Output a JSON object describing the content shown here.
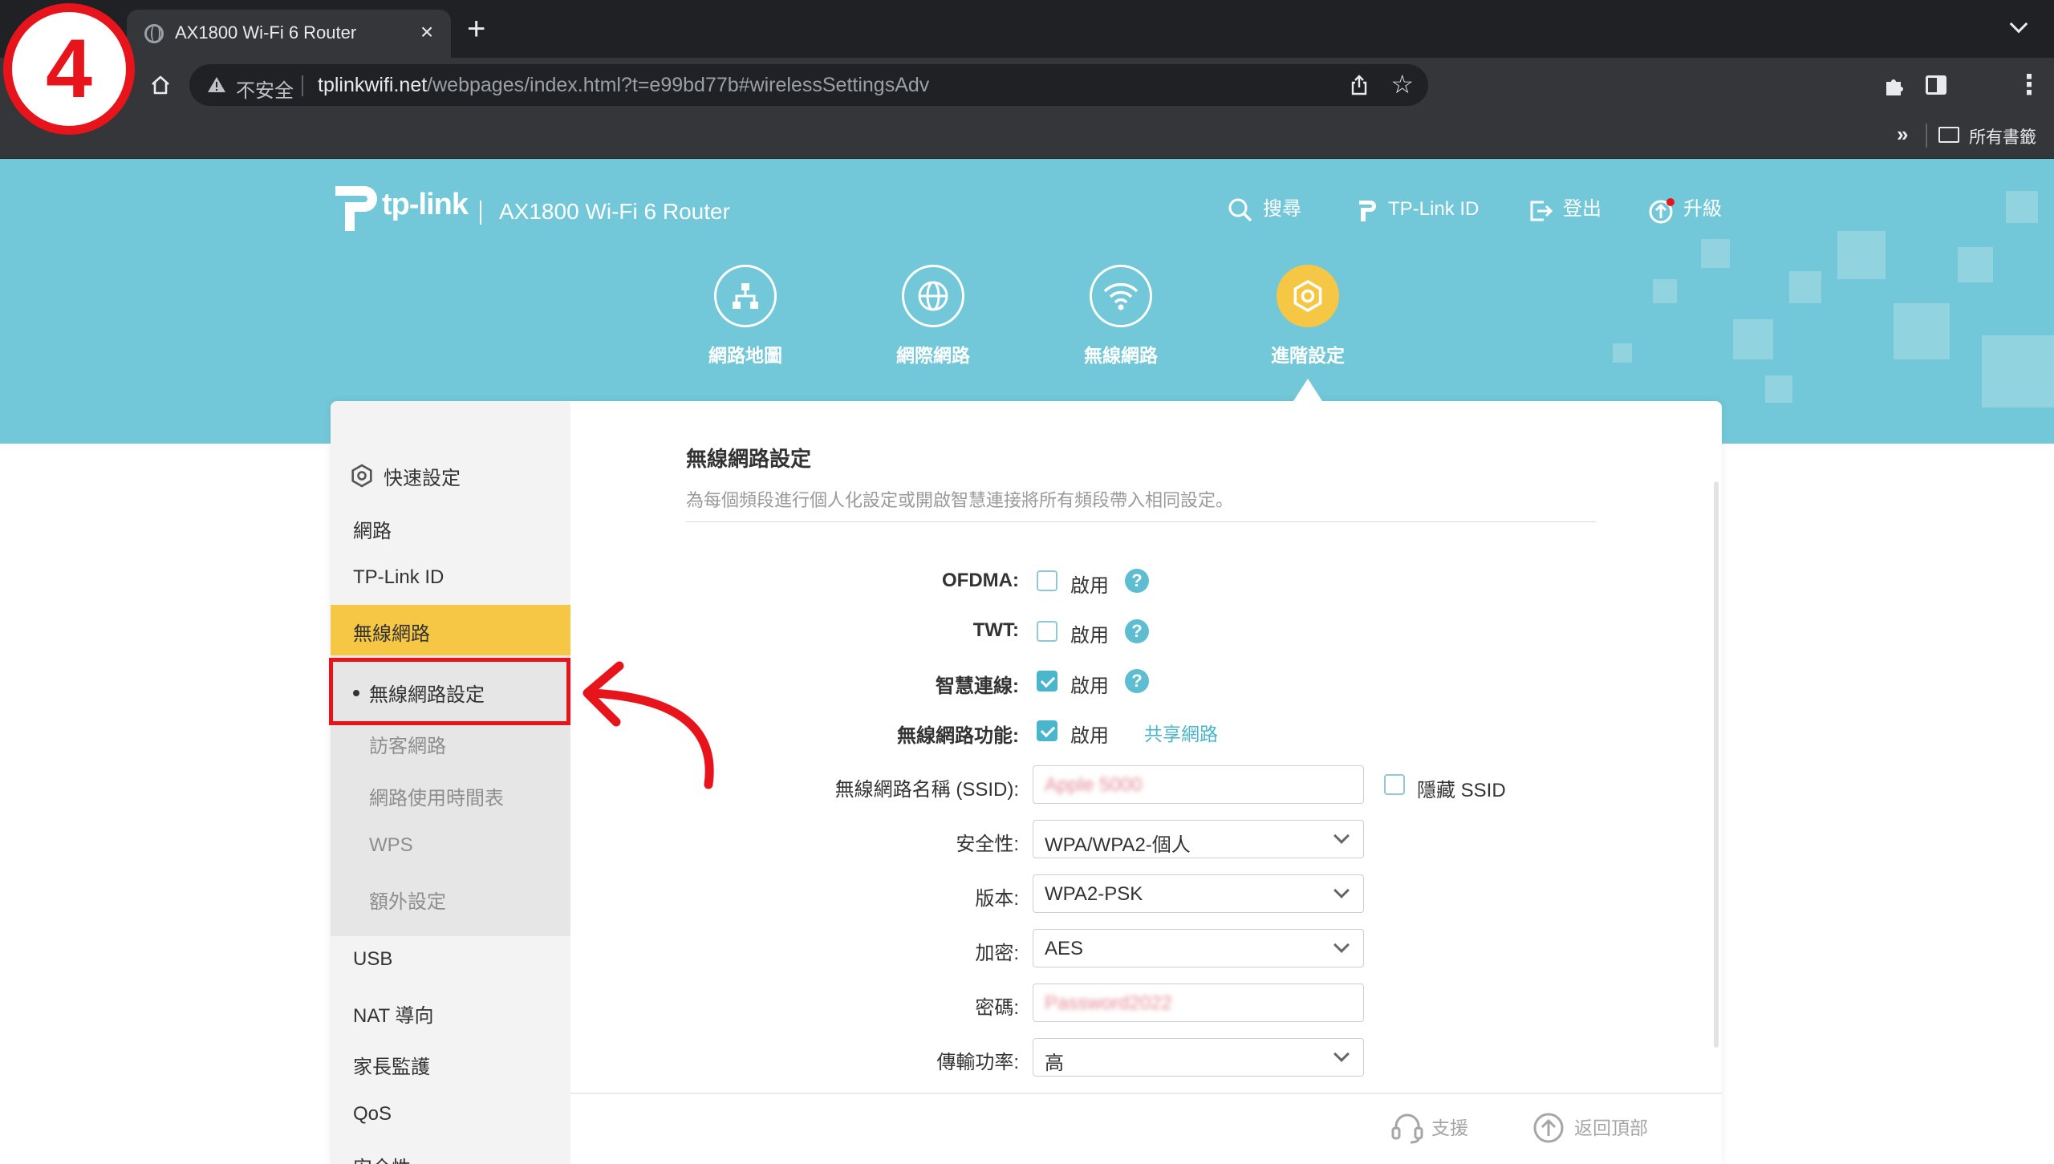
{
  "browser": {
    "tab_title": "AX1800 Wi-Fi 6 Router",
    "tab_close": "×",
    "new_tab": "+",
    "insecure_label": "不安全",
    "url_host": "tplinkwifi.net",
    "url_path": "/webpages/index.html?t=e99bd77b#wirelessSettingsAdv",
    "bookmarks_more": "»",
    "bookmarks_folder": "所有書籤",
    "menu_glyph": "⋮",
    "star_glyph": "☆"
  },
  "annotation": {
    "step_number": "4",
    "accent_color": "#e8141b"
  },
  "header": {
    "logo_text": "tp-link",
    "product_name": "AX1800 Wi-Fi 6 Router",
    "links": {
      "search": "搜尋",
      "tplink_id": "TP-Link ID",
      "logout": "登出",
      "upgrade": "升級"
    }
  },
  "top_nav": {
    "items": [
      {
        "label": "網路地圖",
        "icon": "network-map-icon"
      },
      {
        "label": "網際網路",
        "icon": "globe-icon"
      },
      {
        "label": "無線網路",
        "icon": "wifi-icon"
      },
      {
        "label": "進階設定",
        "icon": "advanced-gear-icon",
        "active": true
      }
    ]
  },
  "sidebar": {
    "quick_setup": "快速設定",
    "network": "網路",
    "tplink_id": "TP-Link ID",
    "wireless": "無線網路",
    "wireless_sub": {
      "settings": "無線網路設定",
      "guest": "訪客網路",
      "schedule": "網路使用時間表",
      "wps": "WPS",
      "additional": "額外設定"
    },
    "usb": "USB",
    "nat": "NAT 導向",
    "parental": "家長監護",
    "qos": "QoS",
    "security": "安全性"
  },
  "content": {
    "title": "無線網路設定",
    "description": "為每個頻段進行個人化設定或開啟智慧連接將所有頻段帶入相同設定。",
    "enable_label": "啟用",
    "help_glyph": "?",
    "ofdma": {
      "label": "OFDMA:",
      "checked": false
    },
    "twt": {
      "label": "TWT:",
      "checked": false
    },
    "smart_connect": {
      "label": "智慧連線:",
      "checked": true
    },
    "wireless_function": {
      "label": "無線網路功能:",
      "checked": true
    },
    "share_network": "共享網路",
    "ssid_label": "無線網路名稱 (SSID):",
    "ssid_value": "Apple 5000",
    "hide_ssid": {
      "label": "隱藏 SSID",
      "checked": false
    },
    "security_label": "安全性:",
    "security_value": "WPA/WPA2-個人",
    "version_label": "版本:",
    "version_value": "WPA2-PSK",
    "encryption_label": "加密:",
    "encryption_value": "AES",
    "password_label": "密碼:",
    "password_value": "Password2022",
    "tx_power_label": "傳輸功率:",
    "tx_power_value": "高"
  },
  "footer": {
    "support": "支援",
    "back_to_top": "返回頂部"
  },
  "colors": {
    "banner": "#72c8d8",
    "active_yellow": "#f6c744",
    "checkbox_on": "#4ab6cc",
    "link": "#4ab6cc"
  }
}
